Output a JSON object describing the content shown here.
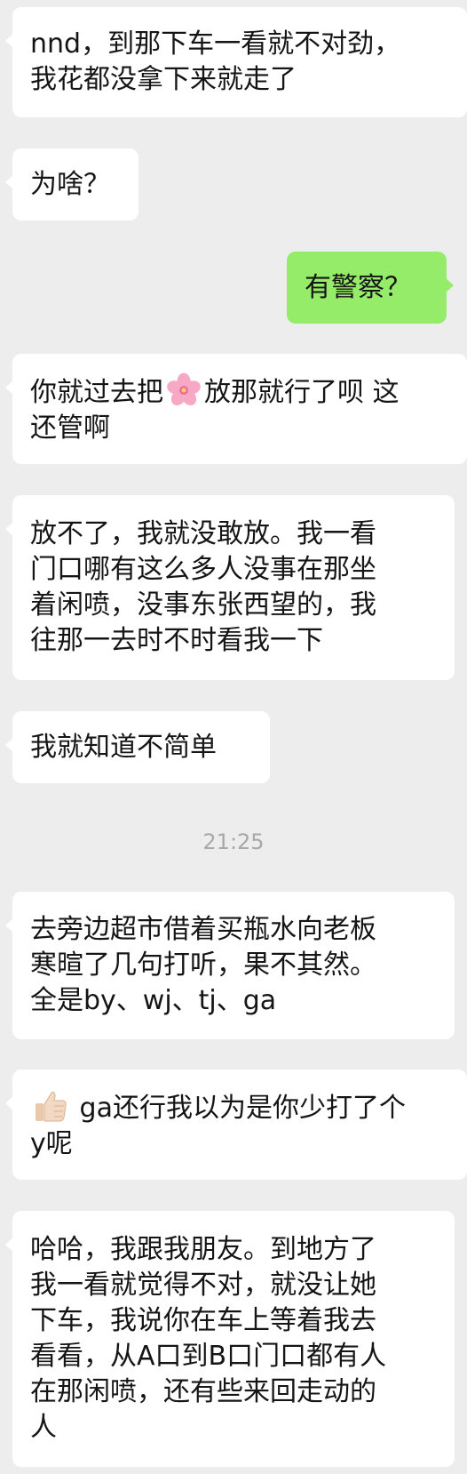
{
  "messages": [
    {
      "side": "in",
      "lines": [
        "nnd，到那下车一看就不对劲，",
        "我花都没拿下来就走了"
      ]
    },
    {
      "side": "in",
      "lines": [
        "为啥？"
      ]
    },
    {
      "side": "out",
      "lines": [
        "有警察？"
      ]
    },
    {
      "side": "in",
      "line1_before": "你就过去把",
      "emoji": "cherry-blossom-icon",
      "line1_after": "放那就行了呗 这",
      "line2": "还管啊"
    },
    {
      "side": "in",
      "lines": [
        "放不了，我就没敢放。我一看",
        "门口哪有这么多人没事在那坐",
        "着闲喷，没事东张西望的，我",
        "往那一去时不时看我一下"
      ]
    },
    {
      "side": "in",
      "lines": [
        "我就知道不简单"
      ]
    },
    {
      "side": "in",
      "lines": [
        "去旁边超市借着买瓶水向老板",
        "寒暄了几句打听，果不其然。",
        "全是by、wj、tj、ga"
      ]
    },
    {
      "side": "in",
      "emoji": "thumbs-up-icon",
      "line1_after": " ga还行我以为是你少打了个",
      "line2": "y呢"
    },
    {
      "side": "in",
      "lines": [
        "哈哈，我跟我朋友。到地方了",
        "我一看就觉得不对，就没让她",
        "下车，我说你在车上等着我去",
        "看看，从A口到B口门口都有人",
        "在那闲喷，还有些来回走动的",
        "人"
      ]
    }
  ],
  "timestamp": "21:25",
  "colors": {
    "background": "#ededed",
    "incoming": "#ffffff",
    "outgoing": "#95ec69",
    "timestamp": "#a8a8a8"
  }
}
